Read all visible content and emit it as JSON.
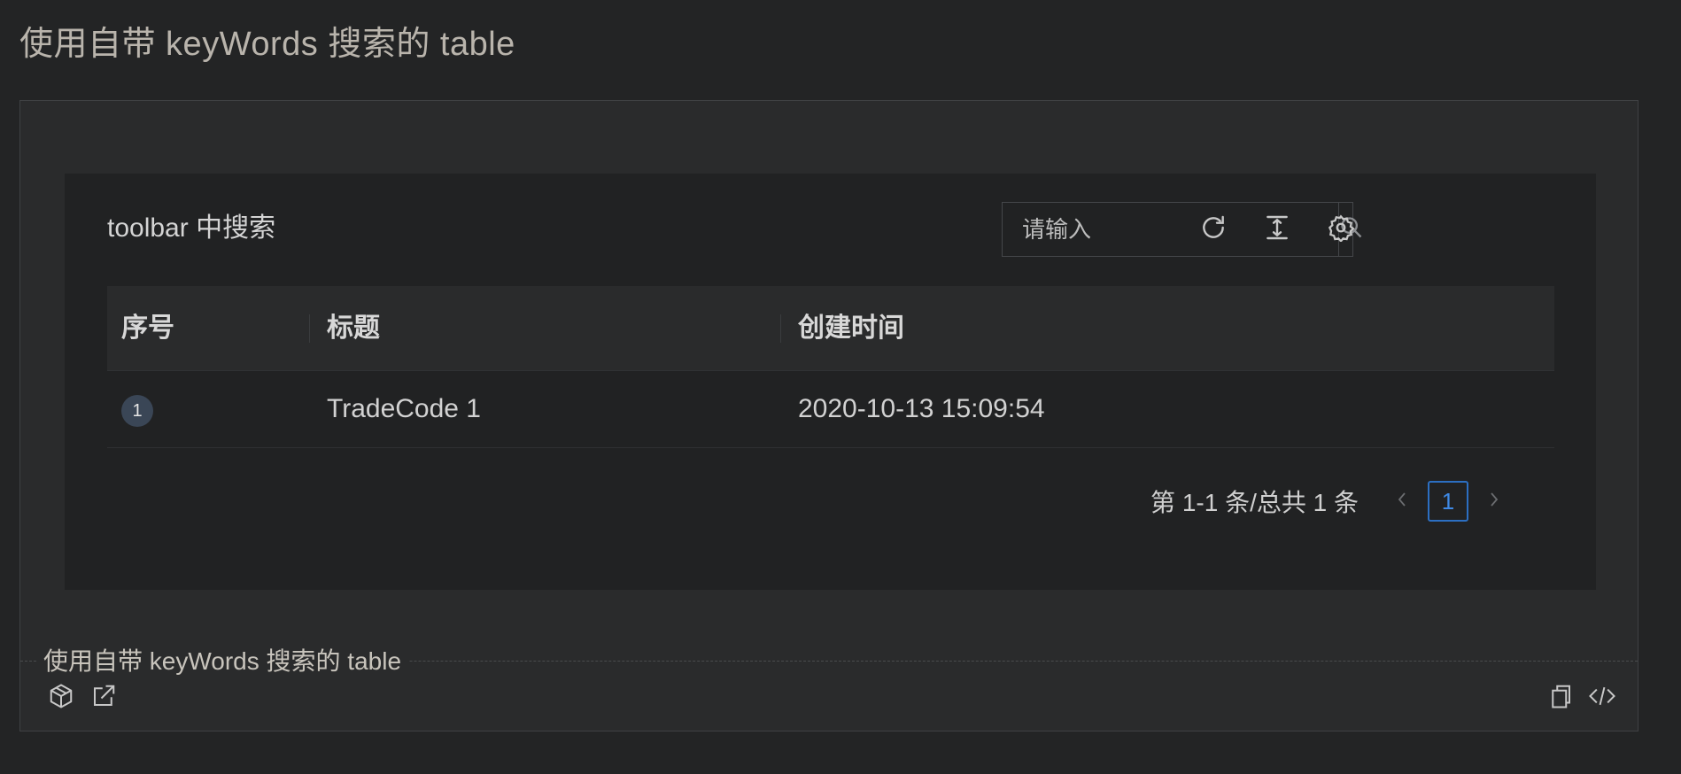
{
  "page": {
    "title": "使用自带 keyWords 搜索的 table"
  },
  "toolbar": {
    "title": "toolbar 中搜索",
    "search": {
      "placeholder": "请输入",
      "value": ""
    },
    "icons": [
      "search-icon",
      "reload-icon",
      "density-icon",
      "settings-icon"
    ]
  },
  "table": {
    "columns": [
      "序号",
      "标题",
      "创建时间"
    ],
    "rows": [
      {
        "index": "1",
        "title": "TradeCode 1",
        "created_at": "2020-10-13 15:09:54"
      }
    ]
  },
  "pagination": {
    "total_text": "第 1-1 条/总共 1 条",
    "current_page": "1"
  },
  "demo_footer": {
    "caption": "使用自带 keyWords 搜索的 table",
    "icons": [
      "codesandbox-icon",
      "open-external-icon",
      "copy-icon",
      "code-icon"
    ]
  },
  "colors": {
    "background": "#232425",
    "accent": "#2c6fc2",
    "card": "#212223"
  }
}
